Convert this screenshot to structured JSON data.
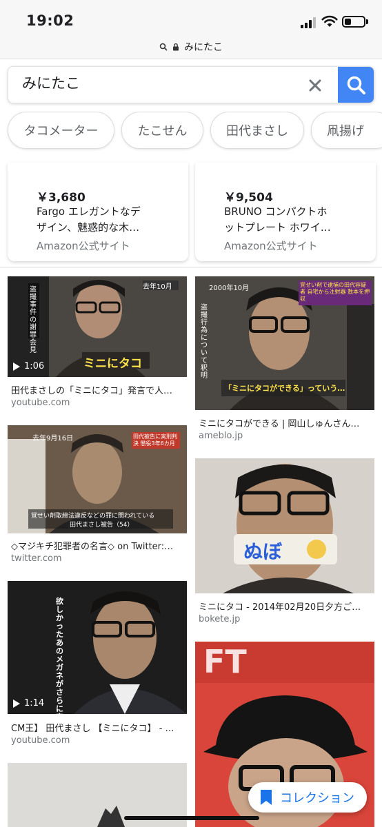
{
  "status_bar": {
    "time": "19:02"
  },
  "url_bar": {
    "url": "みにたこ"
  },
  "search": {
    "query": "みにたこ"
  },
  "chips": [
    {
      "label": "タコメーター"
    },
    {
      "label": "たこせん"
    },
    {
      "label": "田代まさし"
    },
    {
      "label": "凧揚げ"
    }
  ],
  "shopping": [
    {
      "price": "￥3,680",
      "title_line1": "Fargo エレガントなデ",
      "title_line2": "ザイン、魅惑的な木…",
      "source": "Amazon公式サイト"
    },
    {
      "price": "￥9,504",
      "title_line1": "BRUNO コンパクトホ",
      "title_line2": "ットプレート ホワイ…",
      "source": "Amazon公式サイト"
    }
  ],
  "results": [
    {
      "title": "田代まさしの「ミニにタコ」発言で人…",
      "source": "youtube.com",
      "duration": "1:06",
      "overlay_caption": "ミニにタコ",
      "overlay_corner": "去年10月",
      "overlay_side": "盗撮事件の謝罪会見"
    },
    {
      "title": "ミニにタコができる | 岡山しゅんさん…",
      "source": "ameblo.jp",
      "overlay_caption": "「ミニにタコができる」っていう…",
      "overlay_corner": "2000年10月",
      "overlay_side": "盗撮行為について釈明",
      "overlay_top_right": "覚せい剤で逮捕の田代容疑者 自宅から注射器 数本を押収"
    },
    {
      "title": "◇マジキチ犯罪者の名言◇ on Twitter:…",
      "source": "twitter.com",
      "overlay_corner": "去年9月16日",
      "overlay_caption": "覚せい剤取締法違反などの罪に問われている",
      "overlay_name": "田代まさし被告（54）",
      "overlay_top_right": "田代被告に実刑判決 懲役3年6カ月"
    },
    {
      "title": "ミニにタコ - 2014年02月20日夕方ご…",
      "source": "bokete.jp",
      "overlay_caption": "ぬぼ"
    },
    {
      "title": "CM王】 田代まさし 【ミニにタコ】 - …",
      "source": "youtube.com",
      "duration": "1:14",
      "overlay_side": "欲しかったあのメガネがさらに安い"
    },
    {
      "overlay_caption": "FT"
    }
  ],
  "collection": {
    "label": "コレクション"
  },
  "colors": {
    "accent": "#4285f4",
    "link_blue": "#1a73e8",
    "muted": "#70757a",
    "caption_yellow": "#ffe34a"
  }
}
